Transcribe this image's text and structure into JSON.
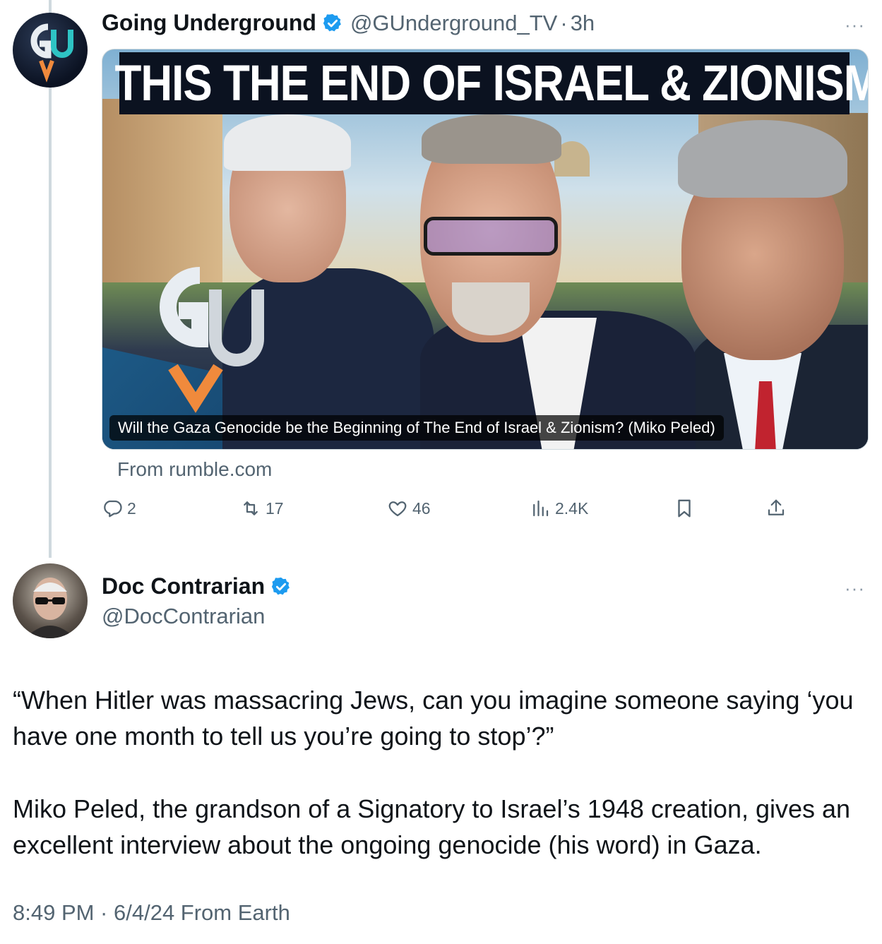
{
  "original_tweet": {
    "author_name": "Going Underground",
    "handle": "@GUnderground_TV",
    "separator": "·",
    "time": "3h",
    "more": "···",
    "media": {
      "title": "IS THIS THE END OF ISRAEL & ZIONISM?",
      "caption": "Will the Gaza Genocide be the Beginning of The End of Israel & Zionism? (Miko Peled)",
      "logo_text": "GU"
    },
    "source": "From rumble.com",
    "actions": {
      "replies": "2",
      "reposts": "17",
      "likes": "46",
      "views": "2.4K"
    }
  },
  "quote_tweet": {
    "author_name": "Doc Contrarian",
    "handle": "@DocContrarian",
    "more": "···",
    "paragraph1": "“When Hitler was massacring Jews, can you imagine someone saying ‘you have one month to tell us you’re going to stop’?”",
    "paragraph2": "Miko Peled, the grandson of a Signatory to Israel’s 1948 creation, gives an excellent interview about the ongoing genocide (his word) in Gaza.",
    "footer": "8:49 PM · 6/4/24 From Earth"
  },
  "colors": {
    "verified": "#1d9bf0",
    "secondary_text": "#536471",
    "thread_line": "#cfd9de"
  },
  "icons": [
    "verified-badge-icon",
    "reply-icon",
    "repost-icon",
    "like-icon",
    "views-icon",
    "bookmark-icon",
    "share-icon",
    "more-icon"
  ]
}
